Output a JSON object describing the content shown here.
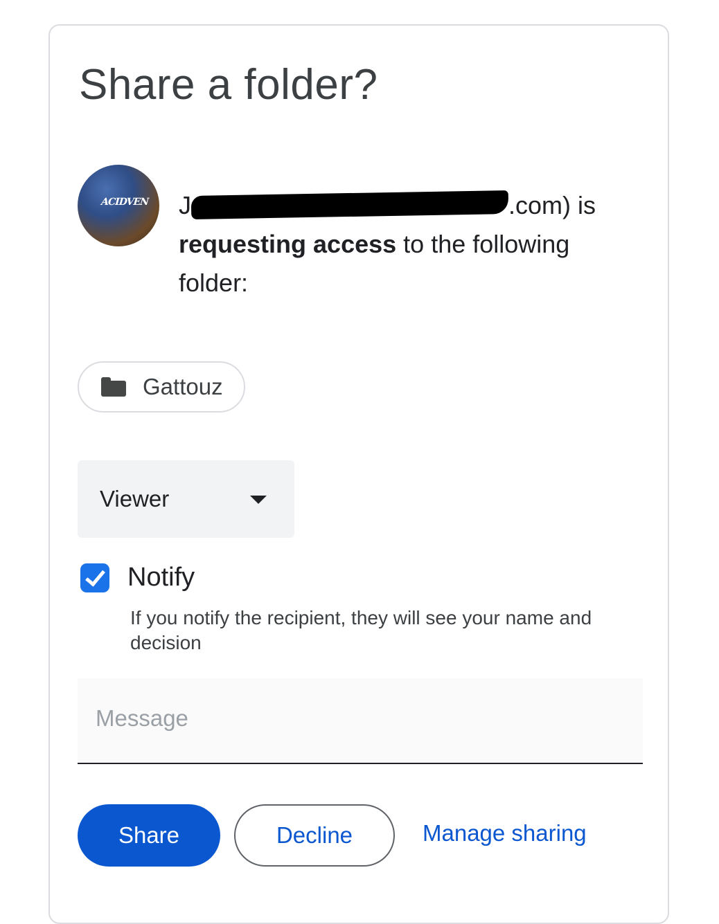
{
  "dialog": {
    "title": "Share a folder?",
    "requester": {
      "name_prefix": "J",
      "email_suffix": ".com) is",
      "bold_text": "requesting access",
      "rest_text": "to the following folder:"
    },
    "folder": {
      "name": "Gattouz",
      "icon": "folder-icon"
    },
    "role": {
      "selected": "Viewer",
      "icon": "caret-down-icon"
    },
    "notify": {
      "label": "Notify",
      "checked": true,
      "hint": "If you notify the recipient, they will see your name and decision"
    },
    "message": {
      "placeholder": "Message",
      "value": ""
    },
    "actions": {
      "share_label": "Share",
      "decline_label": "Decline",
      "manage_label": "Manage sharing"
    }
  },
  "colors": {
    "primary": "#0b57d0",
    "checkbox": "#1a73e8",
    "select_bg": "#f1f3f4"
  }
}
